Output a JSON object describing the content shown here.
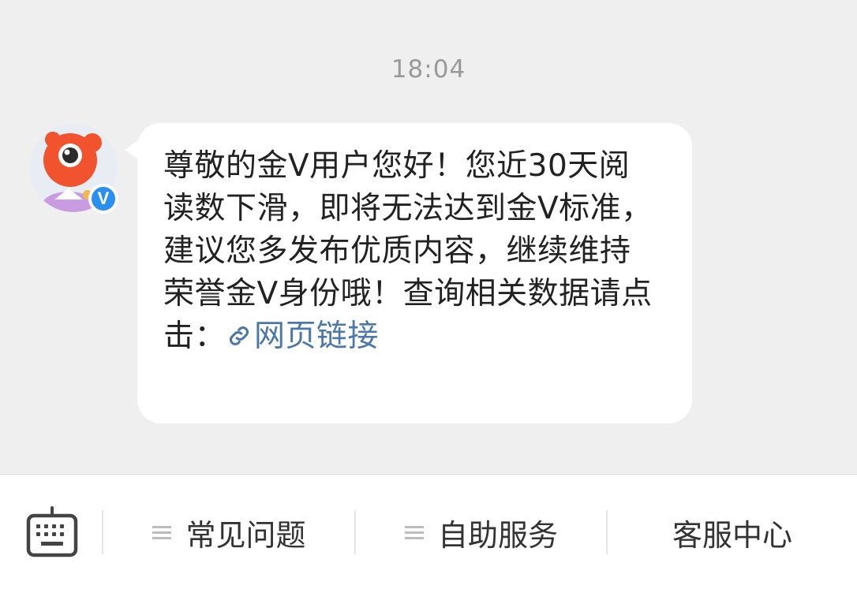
{
  "timestamp": "18:04",
  "message": {
    "sender_icons": {
      "avatar": "weibo-mascot-avatar",
      "badge": "verified-v-badge"
    },
    "badge_text": "V",
    "text": "尊敬的金V用户您好！您近30天阅读数下滑，即将无法达到金V标准，建议您多发布优质内容，继续维持荣誉金V身份哦！查询相关数据请点击：",
    "link_label": "网页链接",
    "link_icon": "link-icon"
  },
  "toolbar": {
    "keyboard_icon": "keyboard-icon",
    "items": [
      {
        "label": "常见问题",
        "icon": "menu-lines-icon"
      },
      {
        "label": "自助服务",
        "icon": "menu-lines-icon"
      },
      {
        "label": "客服中心"
      }
    ]
  },
  "colors": {
    "background": "#efefef",
    "bubble": "#ffffff",
    "link": "#4b78a8",
    "badge": "#2b8ff0",
    "timestamp": "#999999"
  }
}
